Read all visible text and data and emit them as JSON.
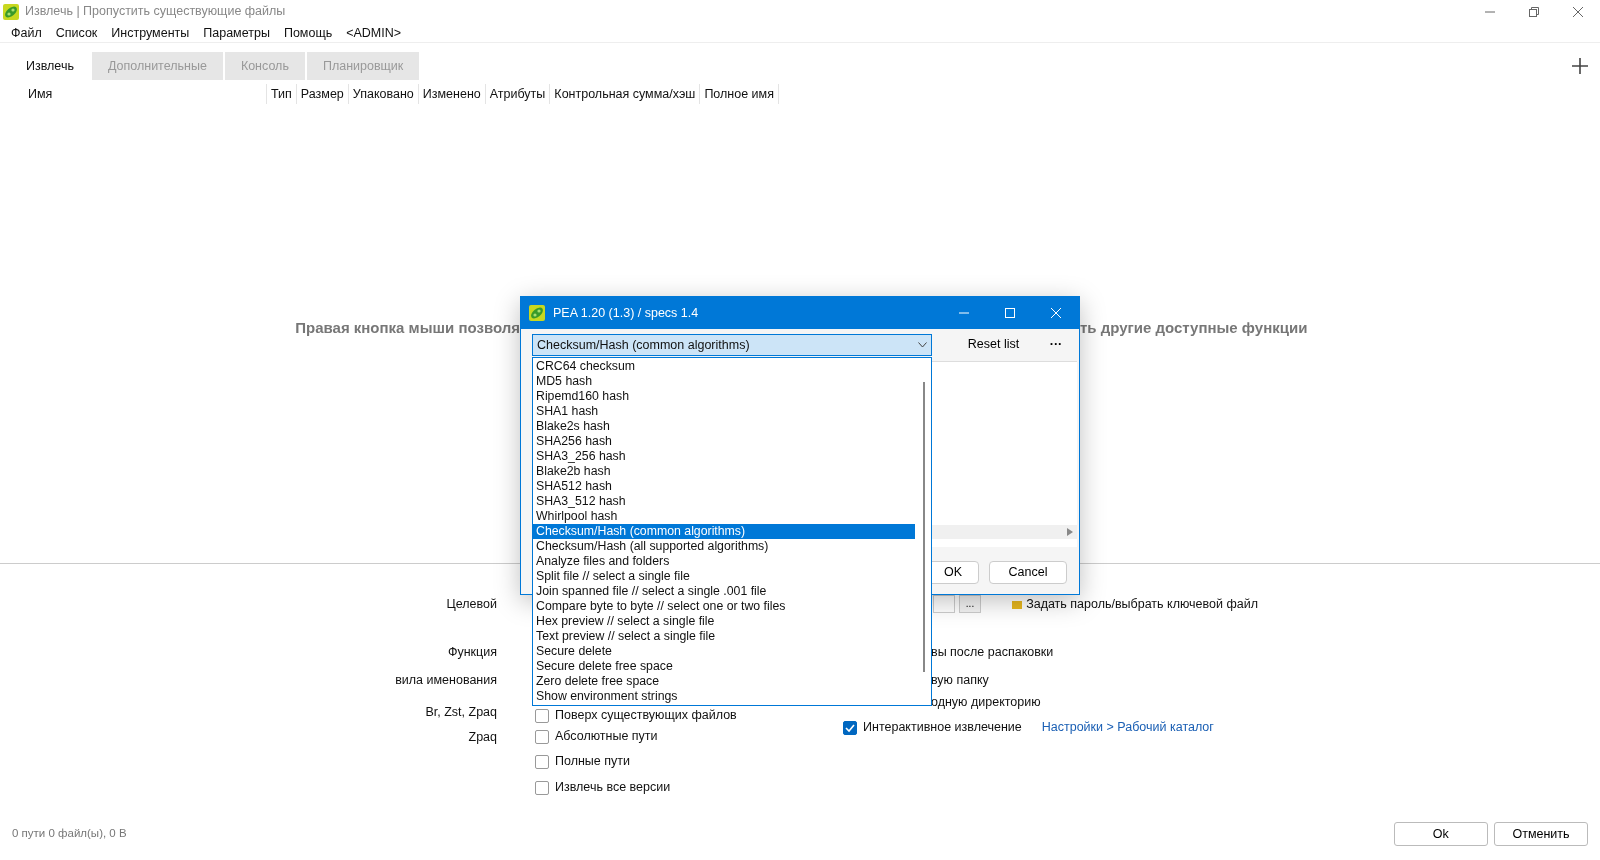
{
  "window": {
    "title": "Извлечь | Пропустить существующие файлы"
  },
  "menu": [
    "Файл",
    "Список",
    "Инструменты",
    "Параметры",
    "Помощь",
    "<ADMIN>"
  ],
  "tabs": [
    {
      "label": "Извлечь",
      "selected": true
    },
    {
      "label": "Дополнительные",
      "selected": false
    },
    {
      "label": "Консоль",
      "selected": false
    },
    {
      "label": "Планировщик",
      "selected": false
    }
  ],
  "columns": [
    "Имя",
    "Тип",
    "Размер",
    "Упаковано",
    "Изменено",
    "Атрибуты",
    "Контрольная сумма/хэш",
    "Полное имя"
  ],
  "hint": {
    "left_part": "Правая кнопка мыши позволя",
    "right_part": "ть другие доступные функции"
  },
  "options": {
    "labels": [
      "Целевой",
      "Функция",
      "вила именования",
      "Br, Zst, Zpaq",
      "Zpaq"
    ],
    "browse_button": "...",
    "password_link": "Задать пароль/выбрать ключевой файл",
    "right_fragments": [
      "вы после распаковки",
      "вую папку",
      "одную директорию"
    ],
    "checks": [
      {
        "label": "Поверх существующих файлов",
        "checked": false
      },
      {
        "label": "Абсолютные пути",
        "checked": false
      },
      {
        "label": "Полные пути",
        "checked": false
      },
      {
        "label": "Извлечь все версии",
        "checked": false
      }
    ],
    "interactive": {
      "label": "Интерактивное извлечение",
      "checked": true
    },
    "settings_link": "Настройки > Рабочий каталог"
  },
  "status_bar": {
    "text": "0 пути 0 файл(ы), 0 B",
    "buttons": [
      "Ok",
      "Отменить"
    ]
  },
  "dialog": {
    "title": "PEA 1.20 (1.3) / specs 1.4",
    "combo_value": "Checksum/Hash (common algorithms)",
    "reset_button": "Reset list",
    "more_button": "···",
    "buttons": [
      "OK",
      "Cancel"
    ],
    "dropdown_items": [
      {
        "label": "CRC64 checksum",
        "selected": false
      },
      {
        "label": "MD5 hash",
        "selected": false
      },
      {
        "label": "Ripemd160 hash",
        "selected": false
      },
      {
        "label": "SHA1 hash",
        "selected": false
      },
      {
        "label": "Blake2s hash",
        "selected": false
      },
      {
        "label": "SHA256 hash",
        "selected": false
      },
      {
        "label": "SHA3_256 hash",
        "selected": false
      },
      {
        "label": "Blake2b hash",
        "selected": false
      },
      {
        "label": "SHA512 hash",
        "selected": false
      },
      {
        "label": "SHA3_512 hash",
        "selected": false
      },
      {
        "label": "Whirlpool hash",
        "selected": false
      },
      {
        "label": "Checksum/Hash (common algorithms)",
        "selected": true
      },
      {
        "label": "Checksum/Hash (all supported algorithms)",
        "selected": false
      },
      {
        "label": "Analyze files and folders",
        "selected": false
      },
      {
        "label": "Split file // select a single file",
        "selected": false
      },
      {
        "label": "Join spanned file // select a single .001 file",
        "selected": false
      },
      {
        "label": "Compare byte to byte // select one or two files",
        "selected": false
      },
      {
        "label": "Hex preview // select a single file",
        "selected": false
      },
      {
        "label": "Text preview // select a single file",
        "selected": false
      },
      {
        "label": "Secure delete",
        "selected": false
      },
      {
        "label": "Secure delete free space",
        "selected": false
      },
      {
        "label": "Zero delete free space",
        "selected": false
      },
      {
        "label": "Show environment strings",
        "selected": false
      }
    ]
  }
}
